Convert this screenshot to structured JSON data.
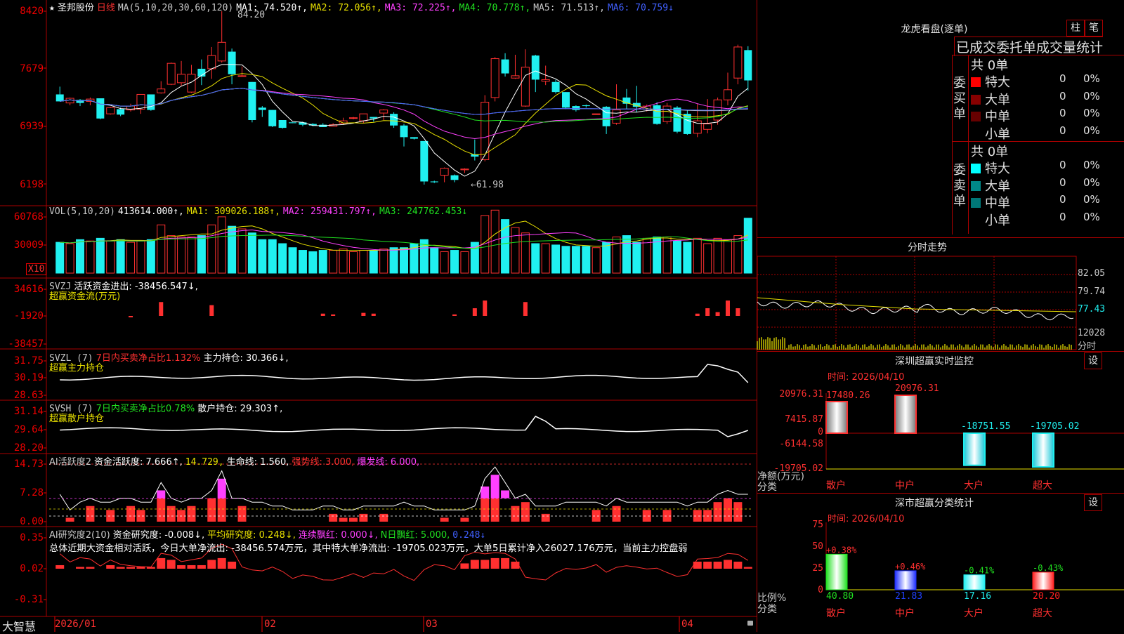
{
  "colors": {
    "up": "#ff3030",
    "down": "#20f0f0",
    "grid": "#aa0000",
    "ma1": "#ffffff",
    "ma2": "#e8e000",
    "ma3": "#ff40ff",
    "ma4": "#20e020",
    "ma5": "#c8c8c8",
    "ma6": "#4060ff"
  },
  "main": {
    "star": "★",
    "name": "圣邦股份",
    "period": "日线",
    "ma_params": "MA(5,10,20,30,60,120)",
    "ma1": "MA1: 74.520↑,",
    "ma2": "MA2: 72.056↑,",
    "ma3": "MA3: 72.225↑,",
    "ma4": "MA4: 70.778↑,",
    "ma5": "MA5: 71.513↑,",
    "ma6": "MA6: 70.759↓",
    "yticks": [
      "8420",
      "7679",
      "6939",
      "6198"
    ],
    "high_label": "84.20",
    "low_label": "←61.98"
  },
  "vol": {
    "label": "VOL(5,10,20)",
    "value": "413614.000↑,",
    "ma1": "MA1: 309026.188↑,",
    "ma2": "MA2: 259431.797↑,",
    "ma3": "MA3: 247762.453↓",
    "yticks": [
      "60768",
      "30009"
    ],
    "unit": "X10"
  },
  "svzj": {
    "label": "SVZJ",
    "title": "活跃资金进出: -38456.547↓,",
    "sub": "超赢资金流(万元)",
    "yticks": [
      "34616",
      "-1920",
      "-38457"
    ]
  },
  "svzl": {
    "label": "SVZL (7)",
    "ratio": "7日内买卖净占比1.132%",
    "hold": "主力持仓: 30.366↓,",
    "sub": "超赢主力持仓",
    "yticks": [
      "31.75",
      "30.19",
      "28.63"
    ]
  },
  "svsh": {
    "label": "SVSH (7)",
    "ratio": "7日内买卖净占比0.78%",
    "hold": "散户持仓: 29.303↑,",
    "sub": "超赢散户持仓",
    "yticks": [
      "31.14",
      "29.64",
      "28.20"
    ]
  },
  "ai1": {
    "label": "AI活跃度2",
    "v1": "资金活跃度: 7.666↑,",
    "v2": "14.729,",
    "v3": "生命线: 1.560,",
    "v4": "强势线: 3.000,",
    "v5": "爆发线: 6.000,",
    "yticks": [
      "14.73",
      "7.28",
      "0.00"
    ]
  },
  "ai2": {
    "label": "AI研究度2(10)",
    "v1": "资金研究度: -0.008↓,",
    "v2": "平均研究度: 0.248↓,",
    "v3": "连续飘红: 0.000↓,",
    "v4": "N日飘红: 5.000,",
    "v5": "0.248↓",
    "summary": "总体近期大资金相对活跃，今日大单净流出: -38456.574万元，其中特大单净流出: -19705.023万元，大单5日累计净入26027.176万元，当前主力控盘弱",
    "yticks": [
      "0.35",
      "0.02",
      "-0.31"
    ]
  },
  "xaxis": {
    "logo": "大智慧",
    "dates": [
      "2026/01",
      "02",
      "03",
      "04"
    ]
  },
  "panel_lhb": {
    "title": "龙虎看盘(逐单)",
    "btn1": "柱",
    "btn2": "笔",
    "header": "已成交委托单成交量统计",
    "buy_side": "委买单",
    "sell_side": "委卖单",
    "buy_total": "共 0单",
    "sell_total": "共 0单",
    "rows": [
      {
        "label": "特大",
        "val": "0",
        "pct": "0%"
      },
      {
        "label": "大单",
        "val": "0",
        "pct": "0%"
      },
      {
        "label": "中单",
        "val": "0",
        "pct": "0%"
      },
      {
        "label": "小单",
        "val": "0",
        "pct": "0%"
      }
    ],
    "buy_colors": [
      "#ff0000",
      "#880000",
      "#660000",
      ""
    ],
    "sell_colors": [
      "#00ffff",
      "#008888",
      "#007777",
      ""
    ]
  },
  "panel_ts": {
    "title": "分时走势",
    "yticks": [
      "82.05",
      "79.74",
      "77.43"
    ],
    "vol_tick": "12028",
    "unit": "分时"
  },
  "panel_rt": {
    "title": "深圳超赢实时监控",
    "btn": "设",
    "time": "时间: 2026/04/10",
    "yticks": [
      "20976.31",
      "7415.87",
      "0",
      "-6144.58",
      "-19705.02"
    ],
    "ylabel": "净额(万元)",
    "xlabel": "分类",
    "bars": [
      {
        "cat": "散户",
        "val": "17480.26",
        "num": 17480.26
      },
      {
        "cat": "中户",
        "val": "20976.31",
        "num": 20976.31
      },
      {
        "cat": "大户",
        "val": "-18751.55",
        "num": -18751.55
      },
      {
        "cat": "超大",
        "val": "-19705.02",
        "num": -19705.02
      }
    ]
  },
  "panel_cls": {
    "title": "深市超赢分类统计",
    "btn": "设",
    "time": "时间: 2026/04/10",
    "yticks": [
      "75",
      "50",
      "25",
      "0"
    ],
    "ylabel": "比例%",
    "xlabel": "分类",
    "bars": [
      {
        "cat": "散户",
        "val": "40.80",
        "num": 40.8,
        "chg": "+0.38%",
        "col": "#20e020"
      },
      {
        "cat": "中户",
        "val": "21.83",
        "num": 21.83,
        "chg": "+0.46%",
        "col": "#2030ff"
      },
      {
        "cat": "大户",
        "val": "17.16",
        "num": 17.16,
        "chg": "-0.41%",
        "col": "#20f0f0"
      },
      {
        "cat": "超大",
        "val": "20.20",
        "num": 20.2,
        "chg": "-0.43%",
        "col": "#ff2020"
      }
    ]
  }
}
